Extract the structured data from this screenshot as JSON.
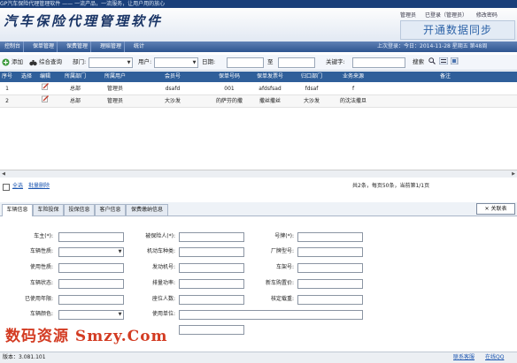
{
  "window": {
    "title": "GP汽车保险代理管理软件 —— 一流产品，一流服务，让用户用的放心"
  },
  "header": {
    "app_title": "汽车保险代理管理软件",
    "user_links": [
      "管理员",
      "已登录（管理员）",
      "修改密码"
    ],
    "sync_button": "开通数据同步"
  },
  "nav": {
    "tabs": [
      "控制台",
      "保单管理",
      "保费管理",
      "理赔管理",
      "统计"
    ],
    "status": "上次登录：今日：2014-11-28 星期五 第48周"
  },
  "toolbar": {
    "add": "添加",
    "combined_query": "综合查询",
    "dept_label": "部门:",
    "user_label": "用户:",
    "date_label": "日期:",
    "to_label": "至",
    "keyword_label": "关键字:",
    "search": "搜索"
  },
  "grid": {
    "columns": [
      "序号",
      "选择",
      "编辑",
      "所属部门",
      "所属用户",
      "会员号",
      "保单号码",
      "保单发票号",
      "归口部门",
      "业务来源",
      "备注"
    ],
    "rows": [
      {
        "no": "1",
        "dept": "总部",
        "user": "管理员",
        "member": "dsafd",
        "policy": "001",
        "invoice": "afdsfsad",
        "branch": "fdsaf",
        "source": "f",
        "note": ""
      },
      {
        "no": "2",
        "dept": "总部",
        "user": "管理员",
        "member": "大沙发",
        "policy": "的萨芬的撒",
        "invoice": "撒丝撒丝",
        "branch": "大沙发",
        "source": "的沈法撒旦",
        "note": ""
      }
    ]
  },
  "paging": {
    "select_all": "全选",
    "batch_delete": "批量删除",
    "info": "共2条，每页50条，当前第1/1页"
  },
  "detail_tabs": [
    "车辆信息",
    "车险投保",
    "投保信息",
    "客户信息",
    "保费缴纳信息"
  ],
  "close_label": "关联表",
  "form": {
    "owner": "车主(*):",
    "insured": "被保险人(*):",
    "plate": "号牌(*):",
    "vehicle_nature": "车辆性质:",
    "vehicle_type": "机动车种类:",
    "model": "厂牌型号:",
    "usage": "使用性质:",
    "engine_no": "发动机号:",
    "vin": "车架号:",
    "status": "车辆状态:",
    "displacement": "排量功率:",
    "new_price": "新车购置价:",
    "years_used": "已使用年限:",
    "seats": "座位人数:",
    "load": "核定载重:",
    "color": "车辆颜色:",
    "unit": "使用单位:"
  },
  "watermark": "数码资源 Smzy.Com",
  "footer": {
    "version": "版本：3.081.101",
    "support": "联系客服",
    "online": "在线QQ"
  }
}
